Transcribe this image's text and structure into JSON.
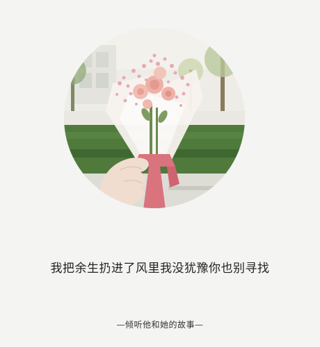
{
  "photo": {
    "subject": "hand-holding-pink-flower-bouquet",
    "colors": {
      "sky": "#f2f1ec",
      "building": "#e7e6e2",
      "hedge": "#4f7a3c",
      "hedge_dark": "#355c2a",
      "grass": "#9bb88a",
      "tree": "#8c7a5c",
      "wrap": "#f7f2ee",
      "ribbon": "#d9737d",
      "rose": "#eeb0a6",
      "baby_breath": "#e7a9b7",
      "hand": "#f0ddd0"
    }
  },
  "quote": "我把余生扔进了风里我没犹豫你也别寻找",
  "signature": "—倾听他和她的故事—"
}
